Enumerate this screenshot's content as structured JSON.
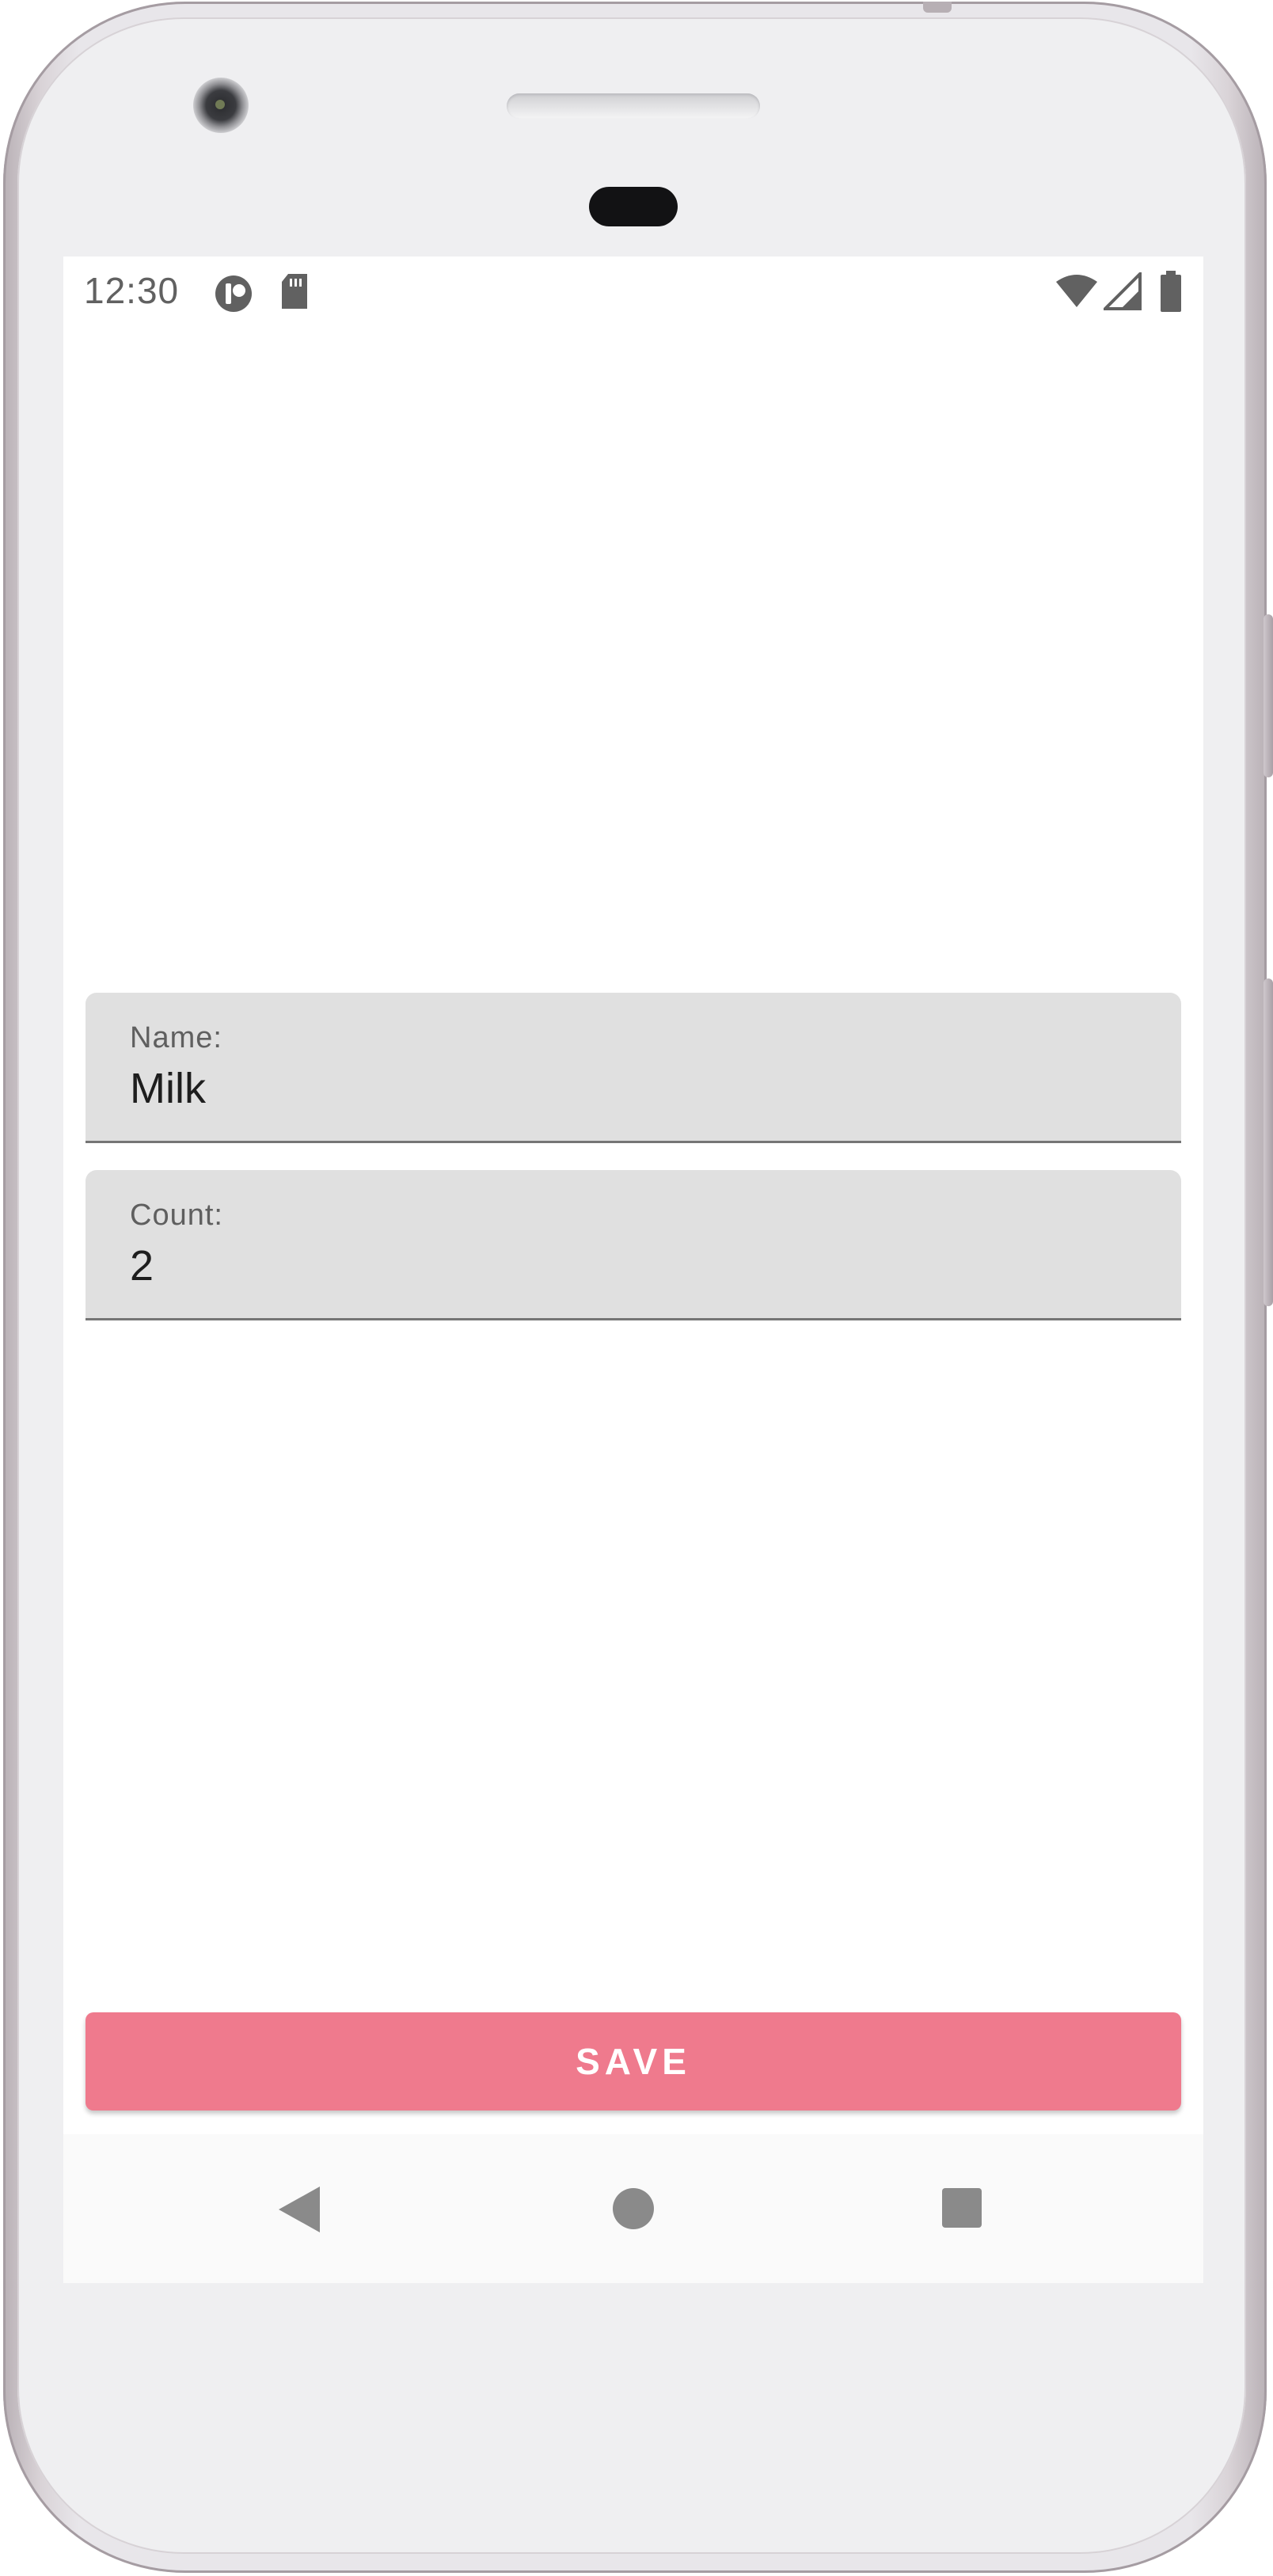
{
  "status_bar": {
    "time": "12:30",
    "icons": [
      "data-saver-icon",
      "sd-card-icon",
      "wifi-icon",
      "cell-signal-icon",
      "battery-icon"
    ]
  },
  "form": {
    "name": {
      "label": "Name:",
      "value": "Milk"
    },
    "count": {
      "label": "Count:",
      "value": "2"
    }
  },
  "actions": {
    "save_label": "SAVE"
  },
  "navigation": {
    "icons": [
      "back-icon",
      "home-icon",
      "recents-icon"
    ]
  },
  "colors": {
    "accent": "#ef7a8d",
    "field_background": "#e0e0e0",
    "status_icons": "#616161"
  }
}
